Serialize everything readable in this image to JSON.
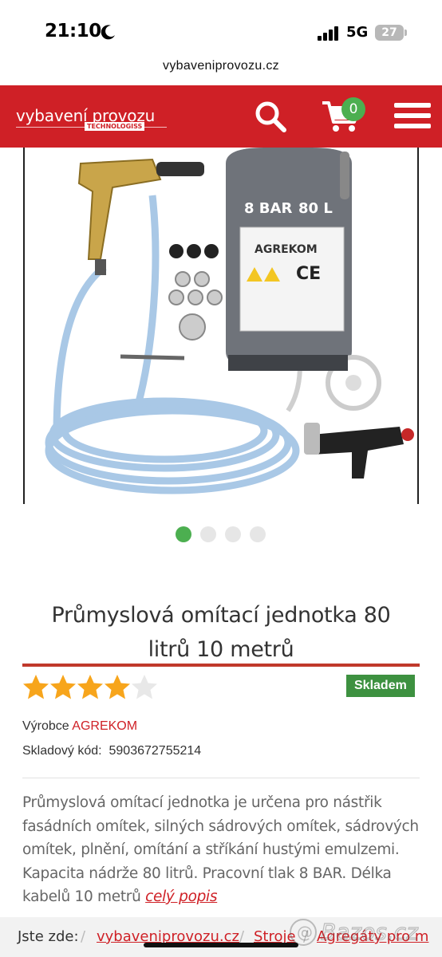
{
  "status_bar": {
    "time": "21:10",
    "network": "5G",
    "battery": "27"
  },
  "browser": {
    "url": "vybaveniprovozu.cz"
  },
  "header": {
    "logo_text": "vybavení provozu",
    "logo_sub": "TECHNOLOGISS",
    "cart_count": "0",
    "accent_color": "#cf2026"
  },
  "gallery": {
    "tank_label_pressure": "8 BAR",
    "tank_label_volume": "80 L",
    "tank_brand": "AGREKOM",
    "tank_ce": "CE",
    "slide_count": 4,
    "active_slide": 1
  },
  "product": {
    "title_line1": "Průmyslová omítací jednotka 80",
    "title_line2": "litrů 10 metrů",
    "rating": 4.5,
    "rating_max": 5,
    "stock": "Skladem",
    "manufacturer_label": "Výrobce",
    "manufacturer": "AGREKOM",
    "sku_label": "Skladový kód:",
    "sku": "5903672755214",
    "description_lines": [
      "Průmyslová omítací jednotka je určena pro nástřik",
      "fasádních omítek, silných sádrových omítek, sádrových",
      "omítek, plnění, omítání a stříkání hustými emulzemi.",
      "Kapacita nádrže 80 litrů. Pracovní tlak 8 BAR. Délka"
    ],
    "description_last": "kabelů 10 metrů",
    "more_link": "celý popis"
  },
  "breadcrumb": {
    "label": "Jste zde:",
    "items": [
      "vybaveniprovozu.cz",
      "Stroje",
      "Agregáty pro m"
    ],
    "separator": "/"
  },
  "watermark": {
    "text": "Bazos.cz"
  }
}
